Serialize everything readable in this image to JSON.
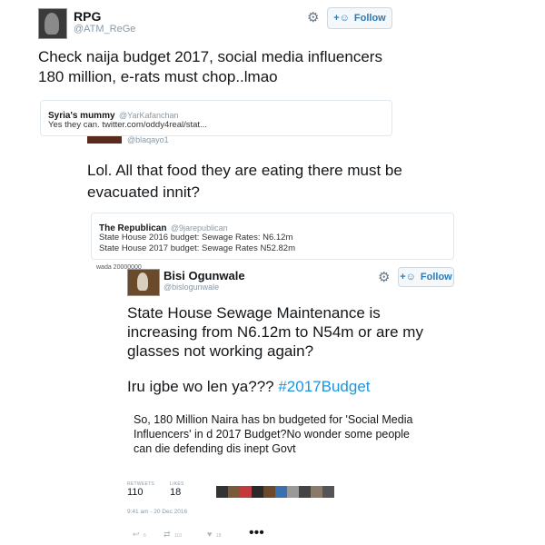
{
  "tweet1": {
    "name": "RPG",
    "handle": "@ATM_ReGe",
    "follow_label": "Follow",
    "text": "Check naija budget 2017, social media influencers 180 million, e-rats must chop..lmao",
    "quote": {
      "name": "Syria's mummy",
      "handle": "@YarKafanchan",
      "text": "Yes they can. twitter.com/oddy4real/stat..."
    }
  },
  "tweet2": {
    "handle": "@blaqayo1",
    "text": "Lol. All that food they are eating there must be evacuated innit?",
    "quote": {
      "name": "The Republican",
      "handle": "@9jarepublican",
      "line1": "State House 2016 budget: Sewage Rates: N6.12m",
      "line2": "State House 2017 budget: Sewage Rates N52.82m"
    },
    "fragment": "wada 20000000"
  },
  "tweet3": {
    "name": "Bisi Ogunwale",
    "handle": "@bislogunwale",
    "follow_label": "Follow",
    "text": "State House Sewage Maintenance is increasing from N6.12m to N54m or are my glasses not working again?",
    "text2_plain": "Iru igbe wo len ya??? ",
    "hashtag": "#2017Budget",
    "text3": "So, 180 Million Naira has bn budgeted for 'Social Media Influencers' in d 2017 Budget?No wonder some people can die defending dis inept Govt",
    "retweets_label": "RETWEETS",
    "retweets": "110",
    "likes_label": "LIKES",
    "likes": "18",
    "timestamp": "9:41 am - 20 Dec 2016",
    "reply_count": "6",
    "retweet_count": "110",
    "like_count": "18"
  },
  "colors": {
    "link": "#1b95e0",
    "follow_text": "#2b7bb9"
  },
  "icons": [
    "gear-icon",
    "follow-person-icon",
    "reply-icon",
    "retweet-icon",
    "like-icon",
    "more-icon"
  ]
}
